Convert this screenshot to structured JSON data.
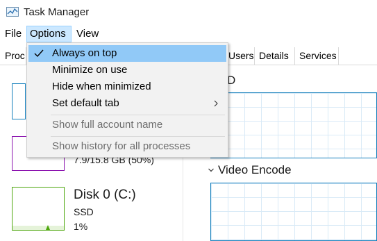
{
  "window": {
    "title": "Task Manager",
    "app_icon": "task-manager-icon"
  },
  "menubar": {
    "items": [
      {
        "label": "File"
      },
      {
        "label": "Options"
      },
      {
        "label": "View"
      }
    ],
    "active": "Options"
  },
  "tabs": [
    {
      "label": "Proc"
    },
    {
      "label": "Users"
    },
    {
      "label": "Details"
    },
    {
      "label": "Services"
    }
  ],
  "options_menu": {
    "items": [
      {
        "label": "Always on top",
        "checked": true,
        "enabled": true
      },
      {
        "label": "Minimize on use",
        "checked": false,
        "enabled": true
      },
      {
        "label": "Hide when minimized",
        "checked": false,
        "enabled": true
      },
      {
        "label": "Set default tab",
        "checked": false,
        "enabled": true,
        "submenu": true
      },
      {
        "label": "Show full account name",
        "checked": false,
        "enabled": false
      },
      {
        "label": "Show history for all processes",
        "checked": false,
        "enabled": false
      }
    ]
  },
  "sidebar": {
    "memory": {
      "value": "7.9/15.8 GB (50%)"
    },
    "disk": {
      "name": "Disk 0 (C:)",
      "type": "SSD",
      "usage": "1%"
    }
  },
  "main": {
    "top_section_letter": "D",
    "video_encode_title": "Video Encode"
  },
  "colors": {
    "cpu": "#117dbb",
    "memory": "#8b12ae",
    "disk": "#4da60c",
    "menu_highlight": "#91c9f7",
    "menu_bg": "#f2f2f2"
  }
}
